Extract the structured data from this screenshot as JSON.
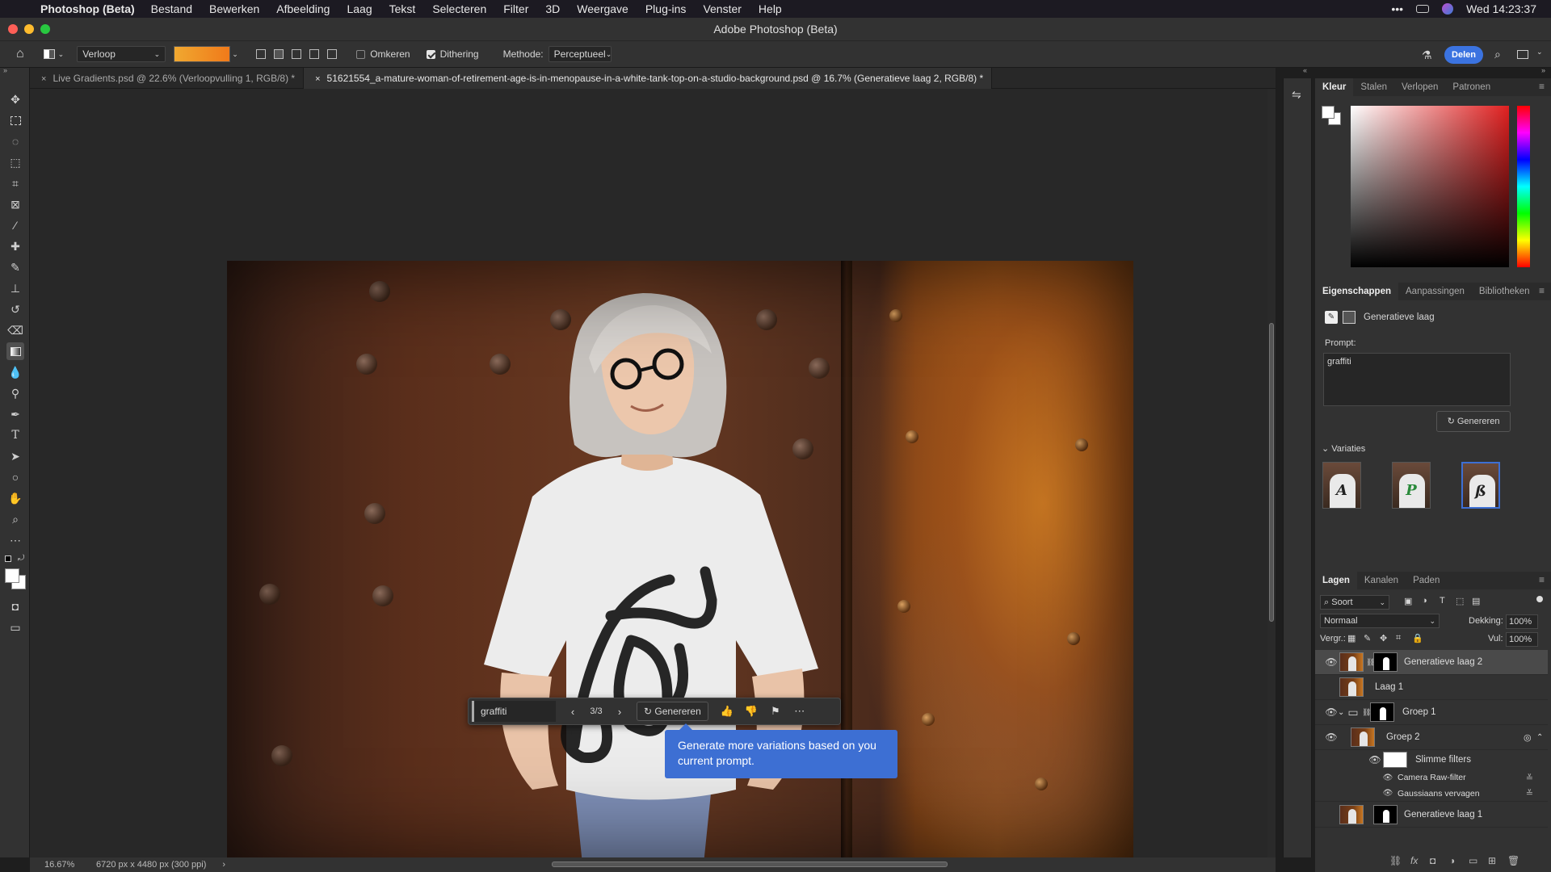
{
  "menubar": {
    "app": "Photoshop (Beta)",
    "items": [
      "Bestand",
      "Bewerken",
      "Afbeelding",
      "Laag",
      "Tekst",
      "Selecteren",
      "Filter",
      "3D",
      "Weergave",
      "Plug-ins",
      "Venster",
      "Help"
    ],
    "clock": "Wed 14:23:37"
  },
  "window": {
    "title": "Adobe Photoshop (Beta)"
  },
  "options": {
    "preset": "Verloop",
    "reverse_label": "Omkeren",
    "reverse_checked": false,
    "dither_label": "Dithering",
    "dither_checked": true,
    "method_label": "Methode:",
    "method_value": "Perceptueel",
    "share_label": "Delen",
    "gradient_colors": [
      "#f0a830",
      "#f07a1a"
    ]
  },
  "tabs": [
    {
      "close": "×",
      "label": "Live Gradients.psd @ 22.6% (Verloopvulling 1, RGB/8) *"
    },
    {
      "close": "×",
      "label": "51621554_a-mature-woman-of-retirement-age-is-in-menopause-in-a-white-tank-top-on-a-studio-background.psd @ 16.7% (Generatieve laag 2, RGB/8) *"
    }
  ],
  "contextbar": {
    "prompt": "graffiti",
    "counter": "3/3",
    "generate_label": "Genereren"
  },
  "tooltip": "Generate more variations based on you current prompt.",
  "status": {
    "zoom": "16.67%",
    "dimensions": "6720 px x 4480 px (300 ppi)"
  },
  "color_panel": {
    "tabs": [
      "Kleur",
      "Stalen",
      "Verlopen",
      "Patronen"
    ]
  },
  "properties": {
    "tabs": [
      "Eigenschappen",
      "Aanpassingen",
      "Bibliotheken"
    ],
    "layer_type": "Generatieve laag",
    "prompt_label": "Prompt:",
    "prompt_value": "graffiti",
    "generate_label": "Genereren",
    "variations_label": "Variaties"
  },
  "layers_panel": {
    "tabs": [
      "Lagen",
      "Kanalen",
      "Paden"
    ],
    "filter_kind": "Soort",
    "blend_mode": "Normaal",
    "opacity_label": "Dekking:",
    "opacity_value": "100%",
    "lock_label": "Vergr.:",
    "fill_label": "Vul:",
    "fill_value": "100%",
    "layers": [
      {
        "name": "Generatieve laag 2"
      },
      {
        "name": "Laag 1"
      },
      {
        "name": "Groep 1"
      },
      {
        "name": "Groep 2"
      },
      {
        "name": "Slimme filters"
      },
      {
        "name": "Camera Raw-filter"
      },
      {
        "name": "Gaussiaans vervagen"
      },
      {
        "name": "Generatieve laag 1"
      }
    ]
  }
}
